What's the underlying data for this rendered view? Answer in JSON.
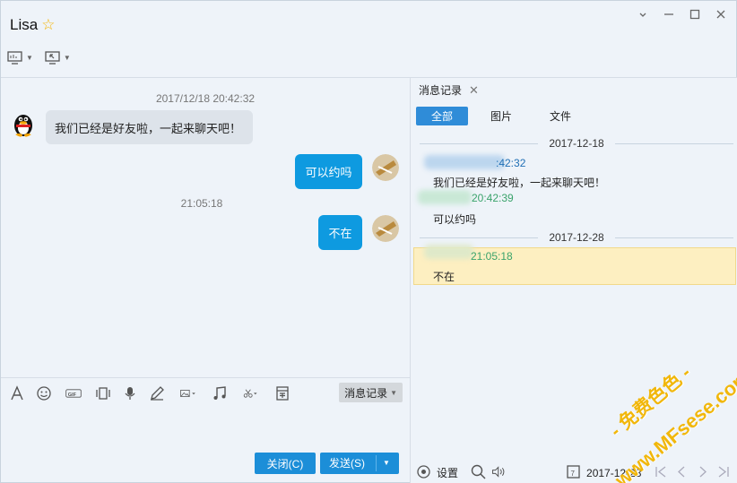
{
  "window": {
    "title": "Lisa"
  },
  "chat": {
    "timestamp_1": "2017/12/18 20:42:32",
    "timestamp_2": "21:05:18",
    "messages": [
      {
        "dir": "in",
        "text": "我们已经是好友啦，一起来聊天吧！"
      },
      {
        "dir": "out",
        "text": "可以约吗"
      },
      {
        "dir": "out",
        "text": "不在"
      }
    ]
  },
  "toolbar": {
    "message_log_label": "消息记录"
  },
  "buttons": {
    "close_label": "关闭(C)",
    "send_label": "发送(S)"
  },
  "history": {
    "tab_label": "消息记录",
    "filters": [
      "全部",
      "图片",
      "文件"
    ],
    "date_1": "2017-12-18",
    "rec_1_time": ":42:32",
    "rec_1_text": "我们已经是好友啦，一起来聊天吧！",
    "rec_2_time": "20:42:39",
    "rec_2_text": "可以约吗",
    "date_2": "2017-12-28",
    "rec_3_time": "21:05:18",
    "rec_3_text": "不在",
    "settings_label": "设置",
    "date_picker": "2017-12-28"
  },
  "watermark": {
    "line1": "- 免费色色 -",
    "line2": "www.MFsese.com"
  },
  "colors": {
    "accent": "#1c8ed8",
    "bubble_out": "#0e9ae0",
    "highlight": "#fdefc1"
  }
}
